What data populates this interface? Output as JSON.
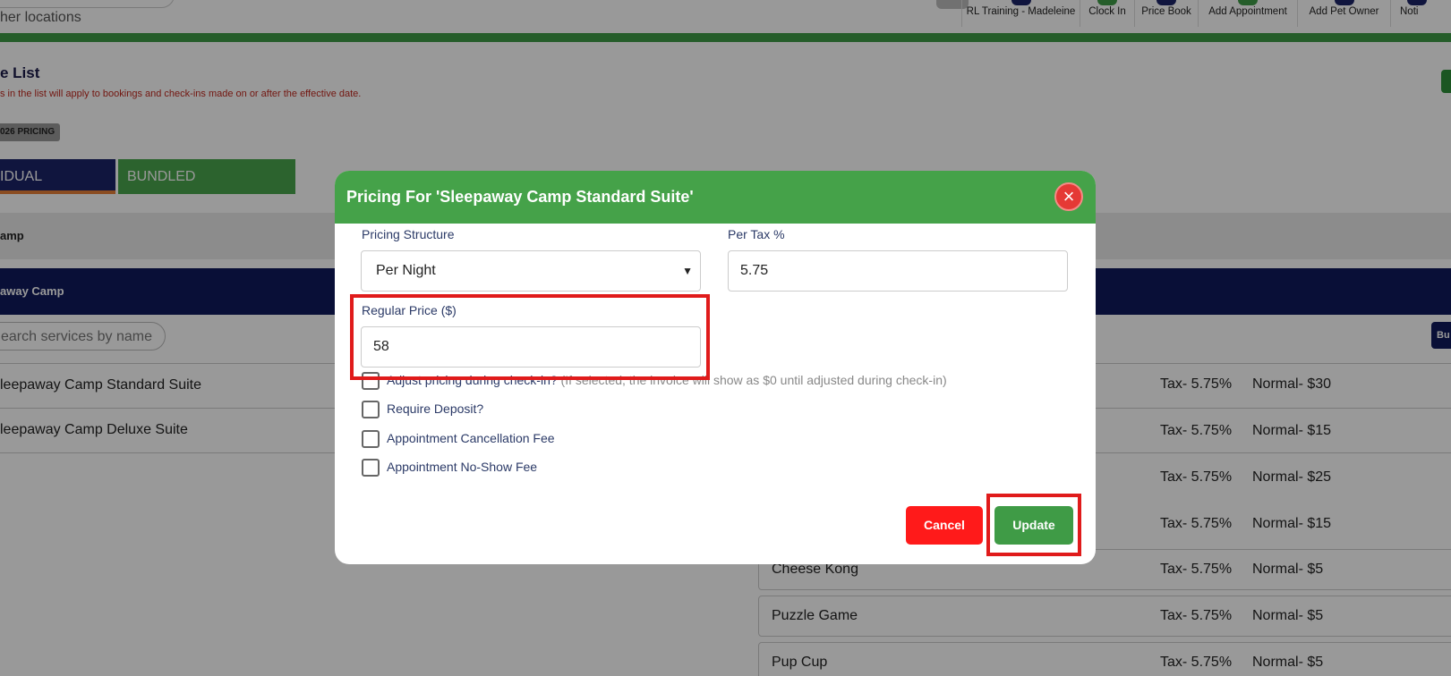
{
  "header": {
    "location_text": "her locations",
    "nav": [
      {
        "label": "RL Training - Madeleine",
        "color": "#1c2468"
      },
      {
        "label": "Clock In",
        "color": "#3f9b46"
      },
      {
        "label": "Price Book",
        "color": "#1c2468"
      },
      {
        "label": "Add Appointment",
        "color": "#3f9b46"
      },
      {
        "label": "Add Pet Owner",
        "color": "#1c2468"
      },
      {
        "label": "Noti",
        "color": "#1c2468"
      }
    ]
  },
  "price_list": {
    "title": "e List",
    "note": "s in the list will apply to bookings and check-ins made on or after the effective date.",
    "badge": "026 PRICING",
    "tabs": [
      "IDUAL SERVICES",
      "BUNDLED EXPERIENCES"
    ],
    "category_label": "amp",
    "category_bar": "away Camp",
    "search_placeholder": "earch services by name",
    "right_button": "Bu",
    "rows": [
      {
        "name": "leepaway Camp Standard Suite",
        "tax": "Tax- 5.75%",
        "normal": "Normal- $30"
      },
      {
        "name": "leepaway Camp Deluxe Suite",
        "tax": "Tax- 5.75%",
        "normal": "Normal- $15"
      },
      {
        "name": "",
        "tax": "Tax- 5.75%",
        "normal": "Normal- $25"
      },
      {
        "name": "",
        "tax": "Tax- 5.75%",
        "normal": "Normal- $15"
      },
      {
        "name": "Cheese Kong",
        "tax": "Tax- 5.75%",
        "normal": "Normal- $5"
      },
      {
        "name": "Puzzle Game",
        "tax": "Tax- 5.75%",
        "normal": "Normal- $5"
      },
      {
        "name": "Pup Cup",
        "tax": "Tax- 5.75%",
        "normal": "Normal- $5"
      }
    ]
  },
  "modal": {
    "title": "Pricing For 'Sleepaway Camp Standard Suite'",
    "close_symbol": "×",
    "pricing_structure_label": "Pricing Structure",
    "pricing_structure_value": "Per Night",
    "tax_label": "Per Tax %",
    "tax_value": "5.75",
    "regular_price_label": "Regular Price ($)",
    "regular_price_value": "58",
    "checkboxes": [
      {
        "label": "Adjust pricing during check-in?",
        "hint": "(If selected, the invoice will show as $0 until adjusted during check-in)",
        "checked": false
      },
      {
        "label": "Require Deposit?",
        "hint": "",
        "checked": false
      },
      {
        "label": "Appointment Cancellation Fee",
        "hint": "",
        "checked": false
      },
      {
        "label": "Appointment No-Show Fee",
        "hint": "",
        "checked": false
      }
    ],
    "cancel_label": "Cancel",
    "update_label": "Update"
  }
}
